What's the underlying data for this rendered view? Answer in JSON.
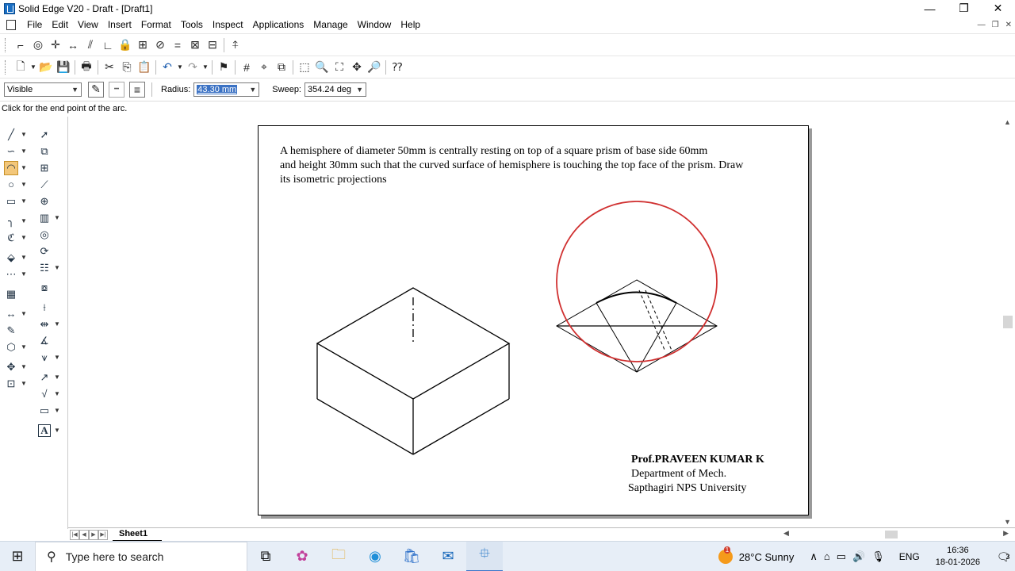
{
  "window": {
    "title": "Solid Edge V20 - Draft - [Draft1]",
    "minimize": "—",
    "restore": "❐",
    "close": "✕"
  },
  "menu": {
    "items": [
      "File",
      "Edit",
      "View",
      "Insert",
      "Format",
      "Tools",
      "Inspect",
      "Applications",
      "Manage",
      "Window",
      "Help"
    ]
  },
  "ribbon": {
    "line_style": "Visible",
    "radius_label": "Radius:",
    "radius_value": "43.30 mm",
    "sweep_label": "Sweep:",
    "sweep_value": "354.24 deg"
  },
  "prompt": "Click for the end point of the arc.",
  "sheet": {
    "problem_line1": "A hemisphere of diameter 50mm is centrally resting on top of a square prism of base side 60mm",
    "problem_line2": "and height 30mm such that the curved surface of hemisphere is touching the top face of the prism. Draw",
    "problem_line3": "its isometric projections",
    "author_name": "Prof.PRAVEEN KUMAR K",
    "author_dept": "Department of Mech.",
    "author_uni": "Sapthagiri NPS University",
    "tab": "Sheet1"
  },
  "taskbar": {
    "search_placeholder": "Type here to search",
    "weather": "28°C  Sunny",
    "language": "ENG",
    "time": "16:36",
    "date": "18-01-2026",
    "notification_count": "3",
    "weather_badge": "1"
  },
  "colors": {
    "arc_highlight": "#d03030",
    "selection": "#3b72c4",
    "taskbar": "#e7eef7"
  }
}
